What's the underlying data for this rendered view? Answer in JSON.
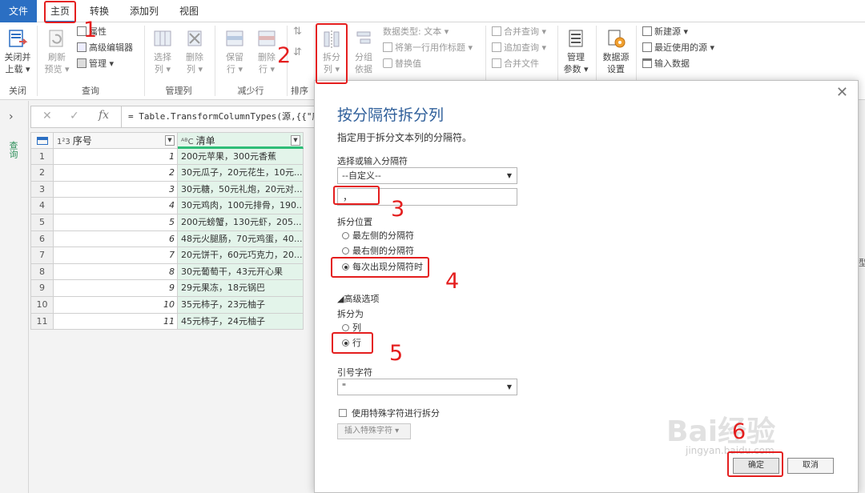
{
  "menu": {
    "file": "文件",
    "home": "主页",
    "transform": "转换",
    "add_column": "添加列",
    "view": "视图"
  },
  "ribbon": {
    "close": {
      "close_load": "关闭并",
      "close_load2": "上载",
      "group": "关闭"
    },
    "query": {
      "refresh": "刷新",
      "refresh2": "预览",
      "properties": "属性",
      "advanced_editor": "高级编辑器",
      "manage": "管理",
      "group": "查询"
    },
    "manage_cols": {
      "select": "选择",
      "select2": "列",
      "remove": "删除",
      "remove2": "列",
      "group": "管理列"
    },
    "reduce_rows": {
      "keep": "保留",
      "keep2": "行",
      "remove": "删除",
      "remove2": "行",
      "group": "减少行"
    },
    "sort": {
      "group": "排序"
    },
    "transform": {
      "split": "拆分",
      "split2": "列",
      "group_by": "分组",
      "group_by2": "依据",
      "data_type": "数据类型: 文本",
      "first_row_header": "将第一行用作标题",
      "replace_values": "替换值"
    },
    "combine": {
      "merge": "合并查询",
      "append": "追加查询",
      "combine_files": "合并文件"
    },
    "params": {
      "manage": "管理",
      "manage2": "参数"
    },
    "datasource": {
      "settings": "数据源",
      "settings2": "设置"
    },
    "newquery": {
      "new_source": "新建源",
      "recent": "最近使用的源",
      "enter_data": "输入数据"
    }
  },
  "query_pane": {
    "label": "查询"
  },
  "formula": {
    "text": "= Table.TransformColumnTypes(源,{{\"序"
  },
  "table": {
    "headers": {
      "num_type": "1²3",
      "num": "序号",
      "list_type": "ᴬᴮC",
      "list": "清单"
    },
    "rows": [
      {
        "idx": "1",
        "num": "1",
        "list": "200元苹果，300元香蕉"
      },
      {
        "idx": "2",
        "num": "2",
        "list": "30元瓜子，20元花生，10元..."
      },
      {
        "idx": "3",
        "num": "3",
        "list": "30元糖，50元礼炮，20元对..."
      },
      {
        "idx": "4",
        "num": "4",
        "list": "30元鸡肉，100元排骨，190..."
      },
      {
        "idx": "5",
        "num": "5",
        "list": "200元螃蟹，130元虾，205..."
      },
      {
        "idx": "6",
        "num": "6",
        "list": "48元火腿肠，70元鸡蛋，40..."
      },
      {
        "idx": "7",
        "num": "7",
        "list": "20元饼干，60元巧克力，20..."
      },
      {
        "idx": "8",
        "num": "8",
        "list": "30元葡萄干，43元开心果"
      },
      {
        "idx": "9",
        "num": "9",
        "list": "29元果冻，18元锅巴"
      },
      {
        "idx": "10",
        "num": "10",
        "list": "35元柿子，23元柚子"
      },
      {
        "idx": "11",
        "num": "11",
        "list": "45元柿子，24元柚子"
      }
    ]
  },
  "dialog": {
    "title": "按分隔符拆分列",
    "subtitle": "指定用于拆分文本列的分隔符。",
    "delim_label": "选择或输入分隔符",
    "delim_select": "--自定义--",
    "delim_value": "，",
    "split_at_label": "拆分位置",
    "opt_left": "最左侧的分隔符",
    "opt_right": "最右侧的分隔符",
    "opt_each": "每次出现分隔符时",
    "advanced": "高级选项",
    "split_into": "拆分为",
    "opt_cols": "列",
    "opt_rows": "行",
    "quote_label": "引号字符",
    "quote_value": "\"",
    "special_chk": "使用特殊字符进行拆分",
    "insert_special": "插入特殊字符",
    "ok": "确定",
    "cancel": "取消"
  },
  "annotations": {
    "n1": "1",
    "n2": "2",
    "n3": "3",
    "n4": "4",
    "n5": "5",
    "n6": "6"
  },
  "watermark": {
    "logo": "Bai经验",
    "url": "jingyan.baidu.com"
  },
  "right_stub": "型",
  "colors": {
    "accent": "#2b6fc3",
    "annotation": "#e41e1e",
    "column_highlight": "#e3f4ea",
    "column_bar": "#2ebd77",
    "title": "#2f5f9a"
  }
}
